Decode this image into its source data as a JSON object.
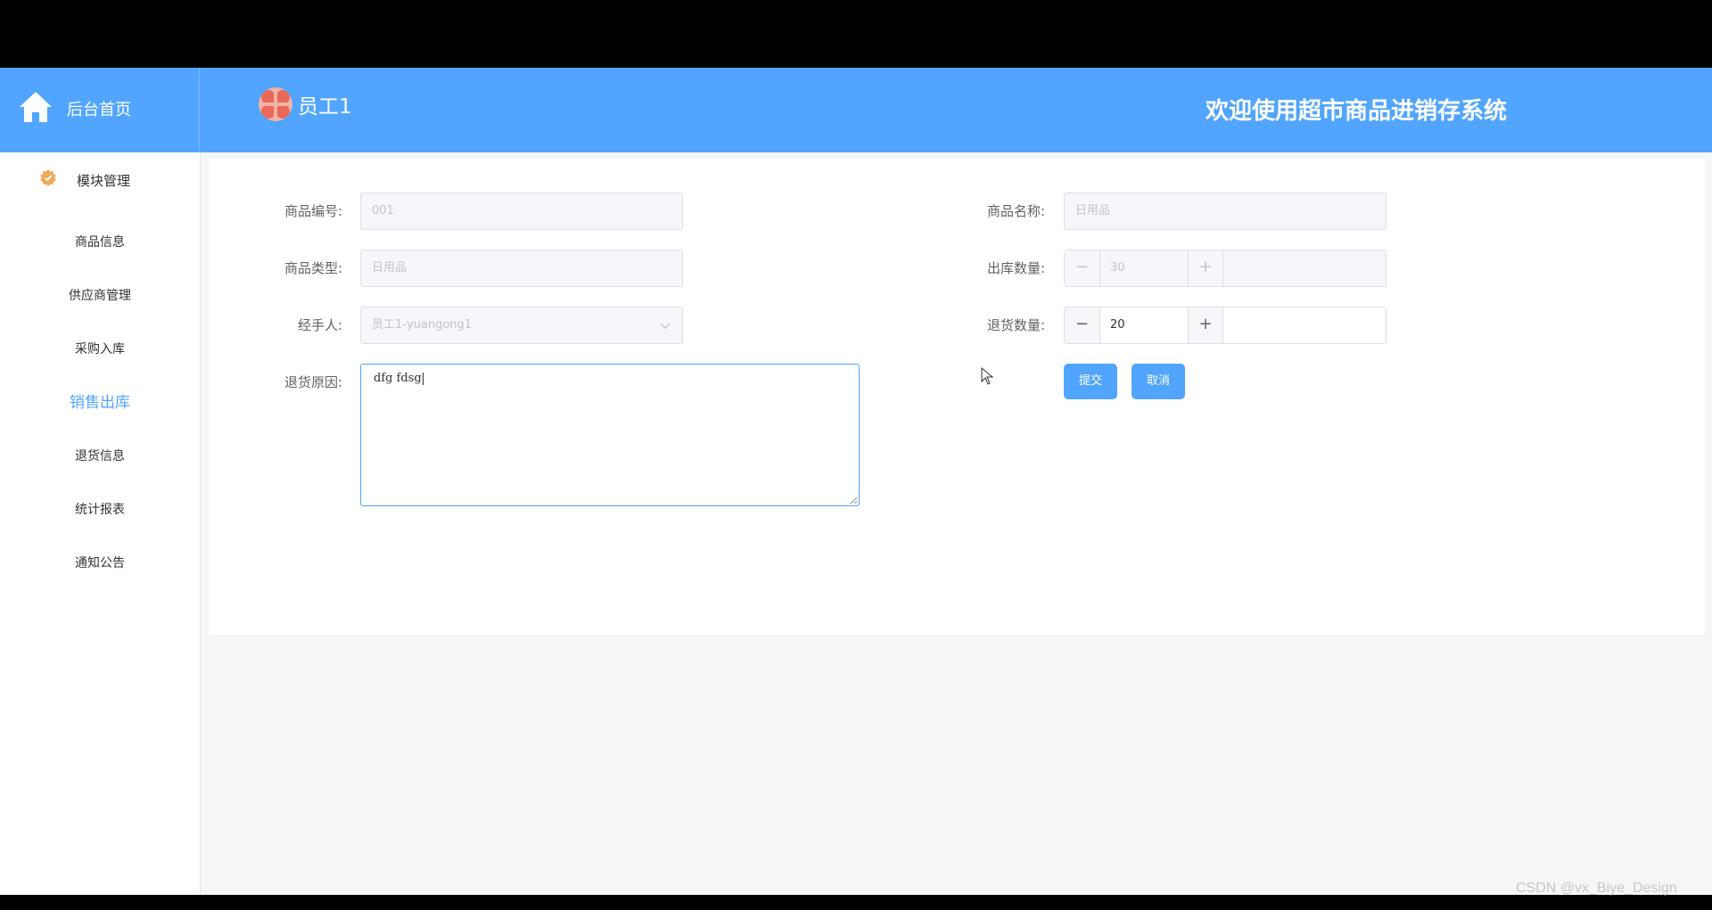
{
  "header": {
    "home_label": "后台首页",
    "user_name": "员工1",
    "welcome": "欢迎使用超市商品进销存系统"
  },
  "sidebar": {
    "group_label": "模块管理",
    "items": [
      {
        "label": "商品信息"
      },
      {
        "label": "供应商管理"
      },
      {
        "label": "采购入库"
      },
      {
        "label": "销售出库",
        "active": true
      },
      {
        "label": "退货信息"
      },
      {
        "label": "统计报表"
      },
      {
        "label": "通知公告"
      }
    ]
  },
  "form": {
    "code_label": "商品编号:",
    "code_value": "001",
    "name_label": "商品名称:",
    "name_value": "日用品",
    "type_label": "商品类型:",
    "type_value": "日用品",
    "out_qty_label": "出库数量:",
    "out_qty_value": "30",
    "handler_label": "经手人:",
    "handler_value": "员工1-yuangong1",
    "return_qty_label": "退货数量:",
    "return_qty_value": "20",
    "reason_label": "退货原因:",
    "reason_value": "dfg fdsg",
    "submit_label": "提交",
    "cancel_label": "取消",
    "minus_symbol": "−",
    "plus_symbol": "+"
  },
  "watermark": "CSDN @vx_Biye_Design",
  "colors": {
    "primary": "#51a5fe",
    "accent_icon": "#f0a85a"
  }
}
